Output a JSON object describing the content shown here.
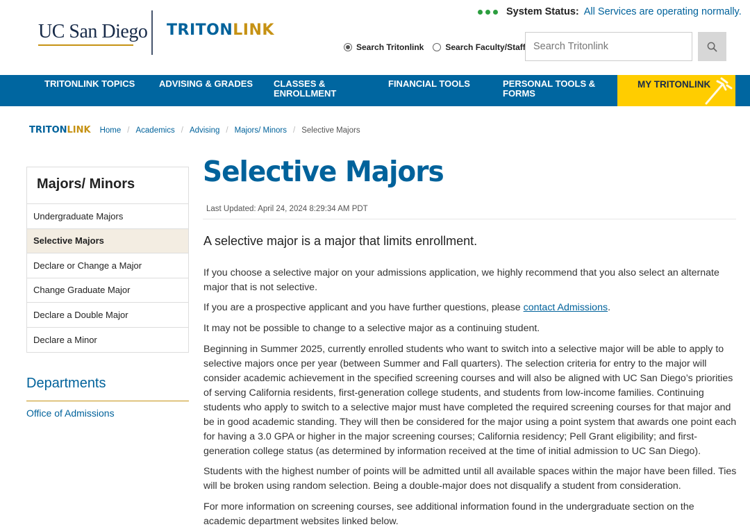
{
  "header": {
    "ucsd_logo": "UC San Diego",
    "tritonlink_part1": "TRITON",
    "tritonlink_part2": "LINK",
    "status_label": "System Status:",
    "status_message": "All Services are operating normally.",
    "radio_tritonlink": "Search Tritonlink",
    "radio_faculty": "Search Faculty/Staff",
    "search_placeholder": "Search Tritonlink"
  },
  "nav": {
    "items": [
      {
        "line1": "TRITONLINK TOPICS",
        "line2": ""
      },
      {
        "line1": "ADVISING & GRADES",
        "line2": ""
      },
      {
        "line1": "CLASSES &",
        "line2": "ENROLLMENT"
      },
      {
        "line1": "FINANCIAL TOOLS",
        "line2": ""
      },
      {
        "line1": "PERSONAL TOOLS &",
        "line2": "FORMS"
      }
    ],
    "my_tritonlink": "MY TRITONLINK"
  },
  "breadcrumb": {
    "brand1": "TRITON",
    "brand2": "LINK",
    "items": [
      "Home",
      "Academics",
      "Advising",
      "Majors/ Minors"
    ],
    "current": "Selective Majors"
  },
  "sidebar": {
    "title": "Majors/ Minors",
    "items": [
      "Undergraduate Majors",
      "Selective Majors",
      "Declare or Change a Major",
      "Change Graduate Major",
      "Declare a Double Major",
      "Declare a Minor"
    ],
    "departments_title": "Departments",
    "departments_link": "Office of Admissions"
  },
  "main": {
    "title": "Selective Majors",
    "last_updated": "Last Updated: April 24, 2024 8:29:34 AM PDT",
    "lead": "A selective major is a major that limits enrollment.",
    "p1": "If you choose a selective major on your admissions application, we highly recommend that you also select an alternate major that is not selective.",
    "p2_before": "If you are a prospective applicant and you have further questions, please ",
    "p2_link": "contact Admissions",
    "p2_after": ".",
    "p3": "It may not be possible to change to a selective major as a continuing student.",
    "p4": "Beginning in Summer 2025, currently enrolled students who want to switch into a selective major will be able to apply to selective majors once per year (between Summer and Fall quarters). The selection criteria for entry to the major will consider academic achievement in the specified screening courses and will also be aligned with UC San Diego’s priorities of serving California residents, first-generation college students, and students from low-income families. Continuing students who apply to switch to a selective major must have completed the required screening courses for that major and be in good academic standing. They will then be considered for the major using a point system that awards one point each for having a 3.0 GPA or higher in the major screening courses; California residency; Pell Grant eligibility; and first-generation college status (as determined by information received at the time of initial admission to UC San Diego).",
    "p5": "Students with the highest number of points will be admitted until all available spaces within the major have been filled. Ties will be broken using random selection. Being a double-major does not disqualify a student from consideration.",
    "p6": "For more information on screening courses, see additional information found in the undergraduate section on the academic department websites linked below."
  },
  "colors": {
    "brand_blue": "#00629b",
    "brand_gold": "#c69214",
    "nav_blue": "#0066a0",
    "my_tritonlink_yellow": "#ffcd00",
    "status_green": "#2c9e3f"
  }
}
